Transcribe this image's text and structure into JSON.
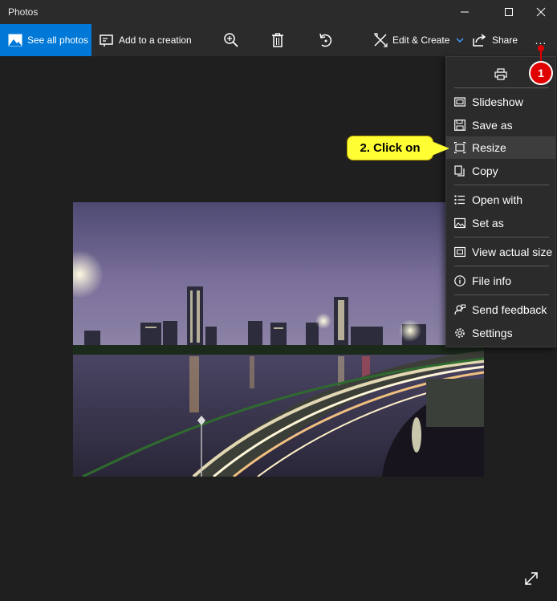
{
  "window": {
    "title": "Photos",
    "controls": [
      "minimize-icon",
      "maximize-icon",
      "close-icon"
    ]
  },
  "toolbar": {
    "see_all": "See all photos",
    "add_creation": "Add to a creation",
    "zoom": "zoom-in-icon",
    "delete": "trash-icon",
    "rotate": "rotate-icon",
    "edit_create": "Edit & Create",
    "share": "Share",
    "more": "..."
  },
  "menu": {
    "print": "printer-icon",
    "items": [
      {
        "label": "Slideshow",
        "icon": "slideshow-icon"
      },
      {
        "label": "Save as",
        "icon": "save-icon"
      },
      {
        "label": "Resize",
        "icon": "resize-icon",
        "highlighted": true
      },
      {
        "label": "Copy",
        "icon": "copy-icon"
      },
      {
        "label": "Open with",
        "icon": "open-with-icon"
      },
      {
        "label": "Set as",
        "icon": "set-as-icon"
      },
      {
        "label": "View actual size",
        "icon": "actual-size-icon"
      },
      {
        "label": "File info",
        "icon": "info-icon"
      },
      {
        "label": "Send feedback",
        "icon": "feedback-icon"
      },
      {
        "label": "Settings",
        "icon": "gear-icon"
      }
    ]
  },
  "annotations": {
    "step1": "1",
    "step2": "2. Click on"
  },
  "colors": {
    "accent": "#0078d7",
    "background": "#1f1f1f",
    "chrome": "#2b2b2b",
    "callout": "#ffff33",
    "badge": "#e00000"
  }
}
